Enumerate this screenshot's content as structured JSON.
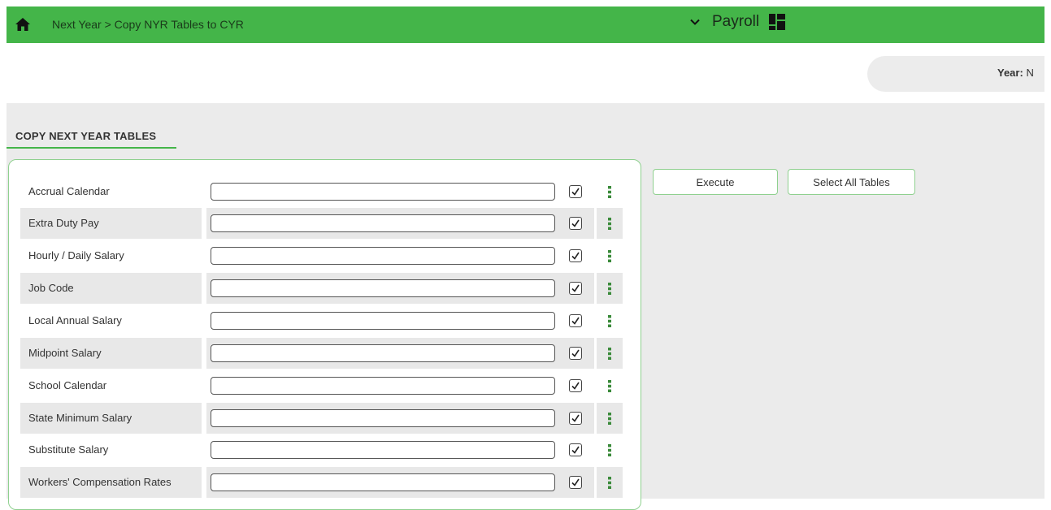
{
  "header": {
    "breadcrumb": "Next Year > Copy NYR Tables to CYR",
    "module": "Payroll",
    "icons": {
      "home": "home-icon",
      "module_dropdown": "chevron-down-icon",
      "module_grid": "grid-icon"
    }
  },
  "year": {
    "label": "Year:",
    "value": "N"
  },
  "section": {
    "title": "COPY NEXT YEAR TABLES"
  },
  "tables": [
    {
      "label": "Accrual Calendar",
      "value": "",
      "checked": true
    },
    {
      "label": "Extra Duty Pay",
      "value": "",
      "checked": true
    },
    {
      "label": "Hourly / Daily Salary",
      "value": "",
      "checked": true
    },
    {
      "label": "Job Code",
      "value": "",
      "checked": true
    },
    {
      "label": "Local Annual Salary",
      "value": "",
      "checked": true
    },
    {
      "label": "Midpoint Salary",
      "value": "",
      "checked": true
    },
    {
      "label": "School Calendar",
      "value": "",
      "checked": true
    },
    {
      "label": "State Minimum Salary",
      "value": "",
      "checked": true
    },
    {
      "label": "Substitute Salary",
      "value": "",
      "checked": true
    },
    {
      "label": "Workers' Compensation Rates",
      "value": "",
      "checked": true
    }
  ],
  "actions": {
    "execute": "Execute",
    "select_all": "Select All Tables"
  },
  "colors": {
    "header_green": "#44b549",
    "accent_border": "#8fd08f",
    "content_bg": "#ebebeb",
    "row_shade": "#e8e8e8"
  }
}
